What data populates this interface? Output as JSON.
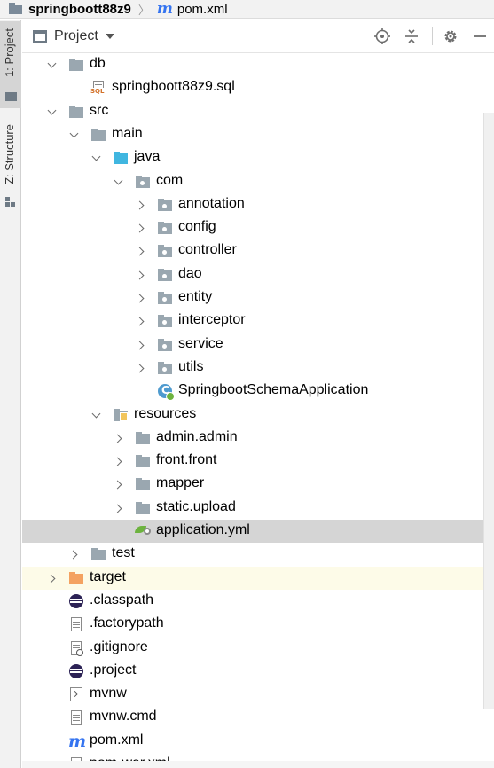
{
  "breadcrumb": {
    "project": "springboott88z9",
    "file": "pom.xml"
  },
  "toolstrip": {
    "project_tab": "1: Project",
    "structure_tab": "Z: Structure"
  },
  "panel": {
    "title": "Project",
    "tools": [
      "locate-icon",
      "collapse-icon",
      "gear-icon",
      "minimize-icon"
    ]
  },
  "tree": [
    {
      "label": "db",
      "depth": 1,
      "arrow": "down",
      "icon": "folder-grey"
    },
    {
      "label": "springboott88z9.sql",
      "depth": 2,
      "arrow": "none",
      "icon": "sql-file"
    },
    {
      "label": "src",
      "depth": 1,
      "arrow": "down",
      "icon": "folder-grey"
    },
    {
      "label": "main",
      "depth": 2,
      "arrow": "down",
      "icon": "folder-grey"
    },
    {
      "label": "java",
      "depth": 3,
      "arrow": "down",
      "icon": "folder-blue"
    },
    {
      "label": "com",
      "depth": 4,
      "arrow": "down",
      "icon": "package"
    },
    {
      "label": "annotation",
      "depth": 5,
      "arrow": "right",
      "icon": "package"
    },
    {
      "label": "config",
      "depth": 5,
      "arrow": "right",
      "icon": "package"
    },
    {
      "label": "controller",
      "depth": 5,
      "arrow": "right",
      "icon": "package"
    },
    {
      "label": "dao",
      "depth": 5,
      "arrow": "right",
      "icon": "package"
    },
    {
      "label": "entity",
      "depth": 5,
      "arrow": "right",
      "icon": "package"
    },
    {
      "label": "interceptor",
      "depth": 5,
      "arrow": "right",
      "icon": "package"
    },
    {
      "label": "service",
      "depth": 5,
      "arrow": "right",
      "icon": "package"
    },
    {
      "label": "utils",
      "depth": 5,
      "arrow": "right",
      "icon": "package"
    },
    {
      "label": "SpringbootSchemaApplication",
      "depth": 5,
      "arrow": "none",
      "icon": "spring-class"
    },
    {
      "label": "resources",
      "depth": 3,
      "arrow": "down",
      "icon": "resources-folder"
    },
    {
      "label": "admin.admin",
      "depth": 4,
      "arrow": "right",
      "icon": "folder-grey"
    },
    {
      "label": "front.front",
      "depth": 4,
      "arrow": "right",
      "icon": "folder-grey"
    },
    {
      "label": "mapper",
      "depth": 4,
      "arrow": "right",
      "icon": "folder-grey"
    },
    {
      "label": "static.upload",
      "depth": 4,
      "arrow": "right",
      "icon": "folder-grey"
    },
    {
      "label": "application.yml",
      "depth": 4,
      "arrow": "none",
      "icon": "yml-file",
      "selected": true
    },
    {
      "label": "test",
      "depth": 2,
      "arrow": "right",
      "icon": "folder-grey"
    },
    {
      "label": "target",
      "depth": 1,
      "arrow": "right",
      "icon": "folder-orange",
      "tinted": true
    },
    {
      "label": ".classpath",
      "depth": 1,
      "arrow": "none",
      "icon": "eclipse-file"
    },
    {
      "label": ".factorypath",
      "depth": 1,
      "arrow": "none",
      "icon": "text-file"
    },
    {
      "label": ".gitignore",
      "depth": 1,
      "arrow": "none",
      "icon": "ignore-file"
    },
    {
      "label": ".project",
      "depth": 1,
      "arrow": "none",
      "icon": "eclipse-file"
    },
    {
      "label": "mvnw",
      "depth": 1,
      "arrow": "none",
      "icon": "cmd-file"
    },
    {
      "label": "mvnw.cmd",
      "depth": 1,
      "arrow": "none",
      "icon": "text-file"
    },
    {
      "label": "pom.xml",
      "depth": 1,
      "arrow": "none",
      "icon": "maven-file"
    },
    {
      "label": "pom-war.xml",
      "depth": 1,
      "arrow": "none",
      "icon": "text-file"
    }
  ]
}
